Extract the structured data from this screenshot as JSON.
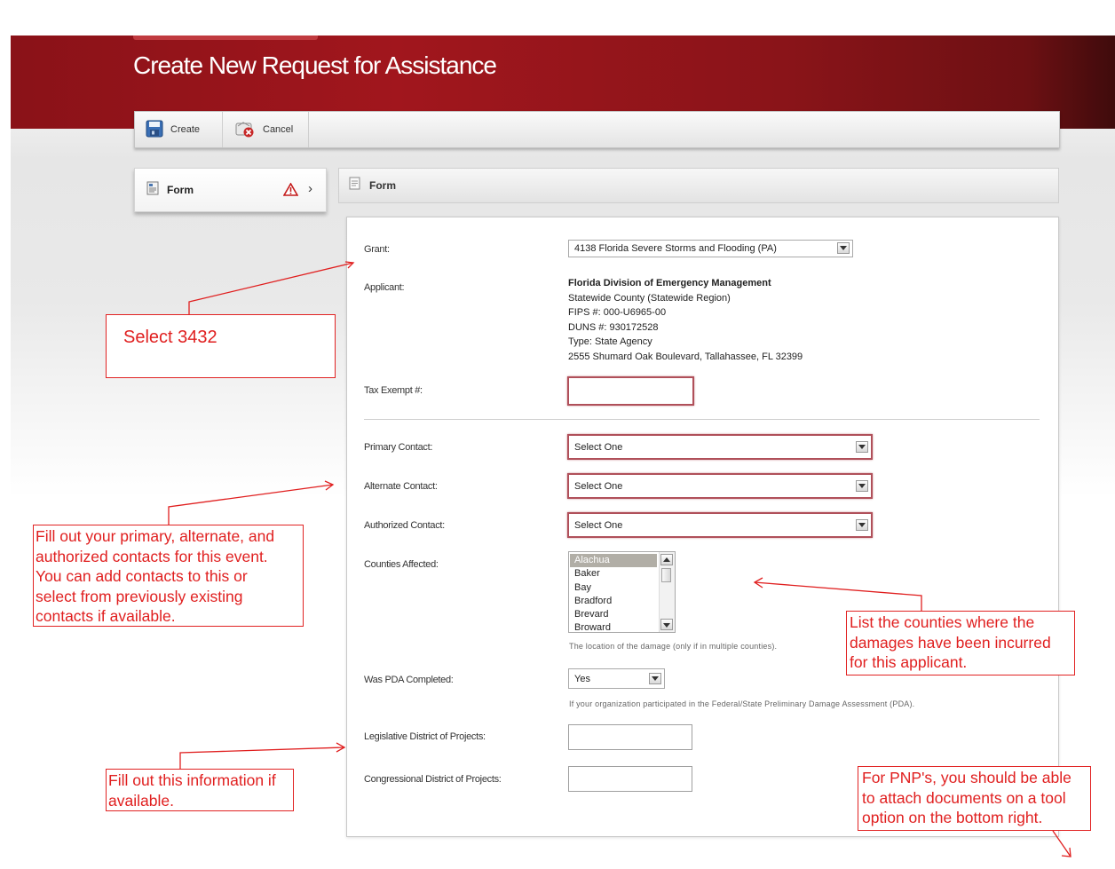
{
  "page": {
    "title": "Create New Request for Assistance"
  },
  "toolbar": {
    "create": {
      "label": "Create",
      "icon": "save-icon"
    },
    "cancel": {
      "label": "Cancel",
      "icon": "cancel-icon"
    }
  },
  "nav": {
    "items": [
      {
        "label": "Form",
        "status_icon": "warning-icon"
      }
    ]
  },
  "form": {
    "header_label": "Form",
    "grant": {
      "label": "Grant:",
      "value": "4138 Florida Severe Storms and Flooding (PA)"
    },
    "applicant": {
      "label": "Applicant:",
      "name": "Florida Division of Emergency Management",
      "county": "Statewide County (Statewide Region)",
      "fips": "FIPS #: 000-U6965-00",
      "duns": "DUNS #: 930172528",
      "type": "Type: State Agency",
      "address": "2555 Shumard Oak Boulevard, Tallahassee, FL  32399"
    },
    "tax_exempt": {
      "label": "Tax Exempt #:",
      "value": ""
    },
    "primary_contact": {
      "label": "Primary Contact:",
      "value": "Select One"
    },
    "alternate_contact": {
      "label": "Alternate Contact:",
      "value": "Select One"
    },
    "authorized_contact": {
      "label": "Authorized Contact:",
      "value": "Select One"
    },
    "counties": {
      "label": "Counties Affected:",
      "options": [
        "Alachua",
        "Baker",
        "Bay",
        "Bradford",
        "Brevard",
        "Broward"
      ],
      "selected": "Alachua",
      "hint": "The location of the damage (only if in multiple counties)."
    },
    "pda": {
      "label": "Was PDA Completed:",
      "value": "Yes",
      "hint": "If your organization participated in the Federal/State Preliminary Damage Assessment (PDA)."
    },
    "legislative": {
      "label": "Legislative District of Projects:",
      "value": ""
    },
    "congressional": {
      "label": "Congressional District of Projects:",
      "value": ""
    }
  },
  "annotations": {
    "select_grant": "Select 3432",
    "contacts": [
      "Fill out your primary, alternate, and",
      "authorized contacts for this event.",
      "You can add contacts to this or",
      "select from previously existing",
      "contacts if available."
    ],
    "counties": [
      "List the counties where the",
      "damages have been incurred",
      "for this applicant."
    ],
    "districts": [
      "Fill out this information if",
      "available."
    ],
    "pnp": [
      "For PNP's, you should be able",
      "to attach documents on a tool",
      "option on the bottom right."
    ],
    "color": "#e01f1f"
  },
  "colors": {
    "header": "#a1161d",
    "required_border": "#b0505a"
  }
}
